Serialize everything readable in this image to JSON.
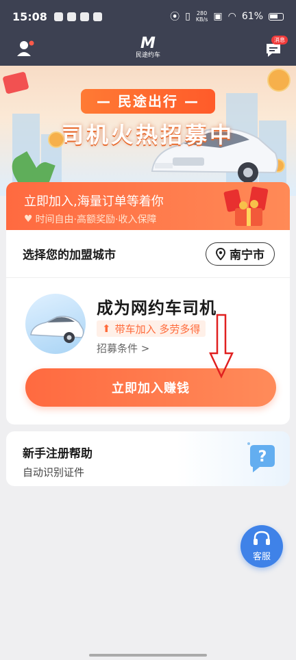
{
  "status_bar": {
    "time": "15:08",
    "network_speed_top": "280",
    "network_speed_bottom": "KB/s",
    "battery": "61%"
  },
  "app_bar": {
    "logo_text": "民途约车",
    "message_badge": "消息"
  },
  "banner": {
    "pill_text": "— 民途出行 —",
    "headline": "司机火热招募中"
  },
  "recruit_card": {
    "head_title": "立即加入,海量订单等着你",
    "head_subtitle": "时间自由·高额奖励·收入保障",
    "city_label": "选择您的加盟城市",
    "city_value": "南宁市",
    "driver_title": "成为网约车司机",
    "driver_tag": "带车加入 多劳多得",
    "driver_conditions": "招募条件 >",
    "join_button": "立即加入赚钱"
  },
  "help_card": {
    "title": "新手注册帮助",
    "subtitle": "自动识别证件"
  },
  "service_button": {
    "label": "客服"
  },
  "colors": {
    "header_bg": "#3d4152",
    "accent_orange": "#ff6a40",
    "service_blue": "#3f82e8"
  }
}
